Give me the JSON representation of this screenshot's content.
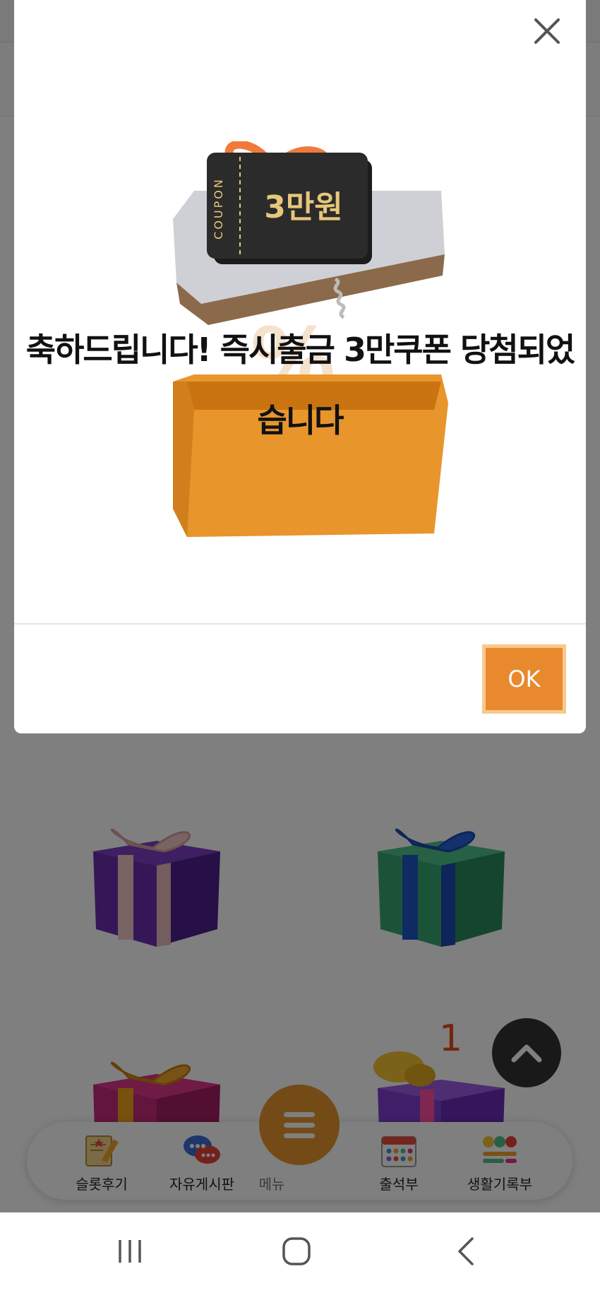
{
  "dialog": {
    "message": "축하드립니다! 즉시출금 3만쿠폰 당첨되었습니다",
    "coupon_label": "COUPON",
    "coupon_amount": "3만원",
    "ok_label": "OK",
    "close_icon": "close-icon"
  },
  "background": {
    "gift_badge_count": "1"
  },
  "bottom_nav": {
    "items": [
      {
        "label": "슬롯후기",
        "icon": "review-pencil-icon"
      },
      {
        "label": "자유게시판",
        "icon": "chat-bubbles-icon"
      },
      {
        "label": "메뉴",
        "icon": "hamburger-menu-icon"
      },
      {
        "label": "출석부",
        "icon": "calendar-icon"
      },
      {
        "label": "생활기록부",
        "icon": "emoji-record-icon"
      }
    ]
  },
  "colors": {
    "accent_orange": "#e8892e",
    "dialog_bg": "#ffffff",
    "dim_overlay": "rgba(0,0,0,0.5)"
  }
}
